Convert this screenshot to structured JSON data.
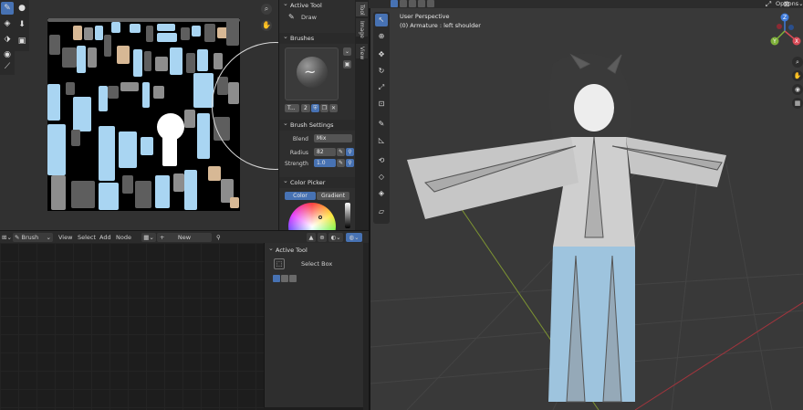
{
  "image_editor": {
    "toolbar_icons": [
      "brush-icon",
      "fill-icon",
      "smear-icon",
      "clone-icon",
      "line-icon"
    ],
    "toolbar2_icons": [
      "drop-icon",
      "dropdown-icon",
      "stack-icon"
    ]
  },
  "npanel": {
    "tabs": [
      "Tool",
      "Image",
      "View"
    ],
    "active_tool": {
      "header": "Active Tool",
      "tool_name": "Draw"
    },
    "brushes": {
      "header": "Brushes",
      "brush_name": "T...",
      "user_count": "2"
    },
    "brush_settings": {
      "header": "Brush Settings",
      "blend_label": "Blend",
      "blend_value": "Mix",
      "radius_label": "Radius",
      "radius_value": "82",
      "strength_label": "Strength",
      "strength_value": "1.0"
    },
    "color_picker": {
      "header": "Color Picker",
      "tab_color": "Color",
      "tab_gradient": "Gradient"
    }
  },
  "node_editor": {
    "header": {
      "mode": "Brush",
      "menu_view": "View",
      "menu_select": "Select",
      "menu_add": "Add",
      "menu_node": "Node",
      "new_button": "New"
    },
    "npanel": {
      "active_tool_header": "Active Tool",
      "tool_name": "Select Box"
    }
  },
  "viewport": {
    "perspective": "User Perspective",
    "object_info": "(0) Armature : left shoulder",
    "options_label": "Options",
    "gizmo_axes": [
      "X",
      "Y",
      "Z"
    ]
  },
  "colors": {
    "accent": "#4772b3",
    "uv_blue": "#a9d5f2",
    "uv_tan": "#d7b895",
    "panel_bg": "#2e2e2e",
    "viewport_bg": "#393939"
  }
}
